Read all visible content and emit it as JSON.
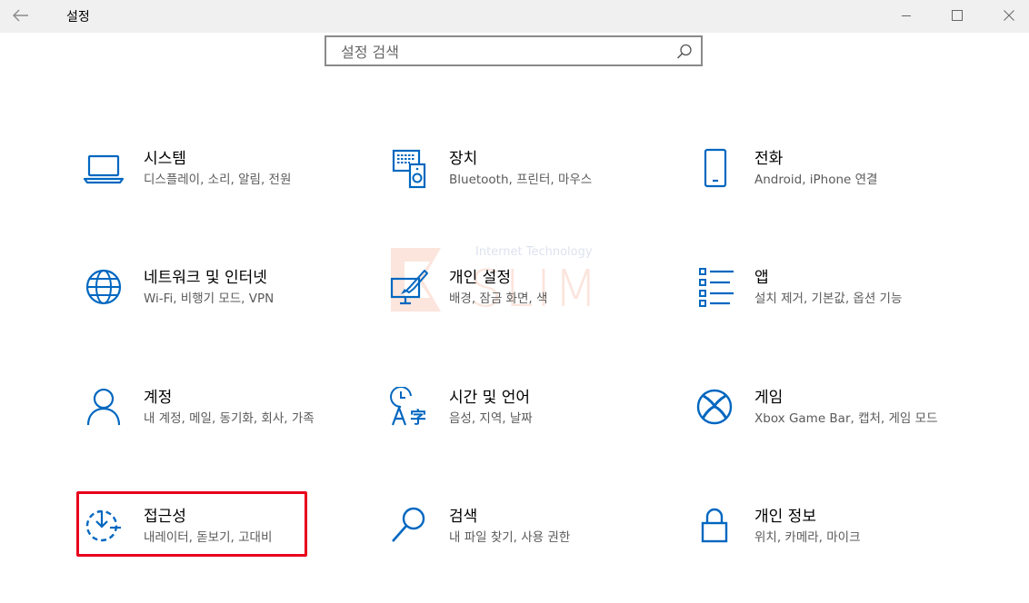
{
  "window": {
    "title": "설정",
    "back_icon": "arrow-left-icon",
    "controls": [
      "minimize-icon",
      "maximize-icon",
      "close-icon"
    ]
  },
  "search": {
    "placeholder": "설정 검색",
    "value": "",
    "icon": "search-icon"
  },
  "accent_color": "#0067c0",
  "highlight_color": "#e8001c",
  "categories": [
    {
      "id": "system",
      "icon": "laptop-icon",
      "title": "시스템",
      "desc": "디스플레이, 소리, 알림, 전원"
    },
    {
      "id": "devices",
      "icon": "devices-icon",
      "title": "장치",
      "desc": "Bluetooth, 프린터, 마우스"
    },
    {
      "id": "phone",
      "icon": "phone-icon",
      "title": "전화",
      "desc": "Android, iPhone 연결"
    },
    {
      "id": "network",
      "icon": "globe-icon",
      "title": "네트워크 및 인터넷",
      "desc": "Wi-Fi, 비행기 모드, VPN"
    },
    {
      "id": "personalization",
      "icon": "paintbrush-icon",
      "title": "개인 설정",
      "desc": "배경, 잠금 화면, 색"
    },
    {
      "id": "apps",
      "icon": "apps-list-icon",
      "title": "앱",
      "desc": "설치 제거, 기본값, 옵션 기능"
    },
    {
      "id": "accounts",
      "icon": "person-icon",
      "title": "계정",
      "desc": "내 계정, 메일, 동기화, 회사, 가족"
    },
    {
      "id": "time-language",
      "icon": "time-language-icon",
      "title": "시간 및 언어",
      "desc": "음성, 지역, 날짜"
    },
    {
      "id": "gaming",
      "icon": "xbox-icon",
      "title": "게임",
      "desc": "Xbox Game Bar, 캡처, 게임 모드"
    },
    {
      "id": "ease-of-access",
      "icon": "ease-of-access-icon",
      "title": "접근성",
      "desc": "내레이터, 돋보기, 고대비"
    },
    {
      "id": "search",
      "icon": "search-icon",
      "title": "검색",
      "desc": "내 파일 찾기, 사용 권한"
    },
    {
      "id": "privacy",
      "icon": "lock-icon",
      "title": "개인 정보",
      "desc": "위치, 카메라, 마이크"
    }
  ],
  "watermark": {
    "top_text": "Internet Technology",
    "brand": "SLIM"
  }
}
